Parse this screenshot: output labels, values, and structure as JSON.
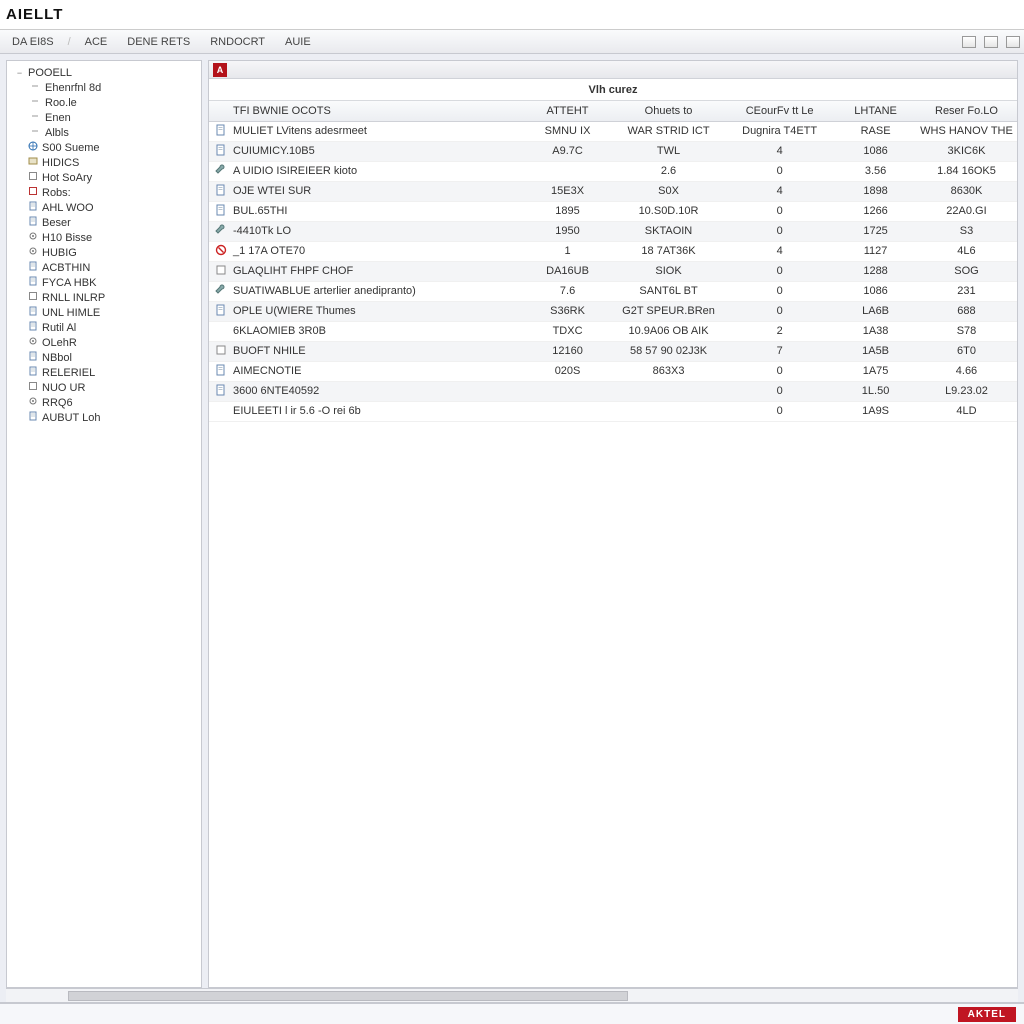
{
  "app": {
    "brand": "AIELLT"
  },
  "menu": {
    "items": [
      "DA EI8S",
      "ACE",
      "DENE RETS",
      "RNDOCRT",
      "AUIE"
    ]
  },
  "sidebar": {
    "root": "POOELL",
    "items": [
      {
        "label": "Ehenrfnl 8d",
        "icon": "dash",
        "indent": 1
      },
      {
        "label": "Roo.le",
        "icon": "dash",
        "indent": 1
      },
      {
        "label": "Enen",
        "icon": "dash",
        "indent": 1
      },
      {
        "label": "Albls",
        "icon": "dash",
        "indent": 1
      },
      {
        "label": "S00 Sueme",
        "icon": "globe",
        "indent": 0
      },
      {
        "label": "HIDICS",
        "icon": "box",
        "indent": 0
      },
      {
        "label": "Hot SoAry",
        "icon": "sq",
        "indent": 0
      },
      {
        "label": "Robs:",
        "icon": "sq-red",
        "indent": 0
      },
      {
        "label": "AHL WOO",
        "icon": "doc",
        "indent": 0
      },
      {
        "label": "Beser",
        "icon": "doc",
        "indent": 0
      },
      {
        "label": "H10 Bisse",
        "icon": "gear",
        "indent": 0
      },
      {
        "label": "HUBIG",
        "icon": "gear",
        "indent": 0
      },
      {
        "label": "ACBTHIN",
        "icon": "doc",
        "indent": 0
      },
      {
        "label": "FYCA HBK",
        "icon": "doc",
        "indent": 0
      },
      {
        "label": "RNLL INLRP",
        "icon": "sq",
        "indent": 0
      },
      {
        "label": "UNL HIMLE",
        "icon": "doc",
        "indent": 0
      },
      {
        "label": "Rutil Al",
        "icon": "doc",
        "indent": 0
      },
      {
        "label": "OLehR",
        "icon": "gear",
        "indent": 0
      },
      {
        "label": "NBbol",
        "icon": "doc",
        "indent": 0
      },
      {
        "label": "RELERIEL",
        "icon": "doc",
        "indent": 0
      },
      {
        "label": "NUO UR",
        "icon": "sq",
        "indent": 0
      },
      {
        "label": "RRQ6",
        "icon": "gear",
        "indent": 0
      },
      {
        "label": "AUBUT Loh",
        "icon": "doc",
        "indent": 0
      }
    ]
  },
  "main": {
    "badge": "A",
    "subtitle": "Vlh curez",
    "columns": [
      "TFI BWNIE OCOTS",
      "ATTEHT",
      "Ohuets to",
      "CEourFv tt Le",
      "LHTANE",
      "Reser Fo.LO"
    ],
    "rows": [
      {
        "icon": "doc",
        "name": "MULIET LVitens adesrmeet",
        "c1": "SMNU IX",
        "c2": "WAR STRID ICT",
        "c3": "Dugnira T4ETT",
        "c4": "RASE",
        "c5": "WHS HANOV THE"
      },
      {
        "icon": "doc",
        "name": "CUIUMICY.10B5",
        "c1": "A9.7C",
        "c2": "TWL",
        "c3": "4",
        "c4": "1086",
        "c5": "3KIC6K"
      },
      {
        "icon": "wrench",
        "name": "A UIDIO ISIREIEER kioto",
        "c1": "",
        "c2": "2.6",
        "c3": "0",
        "c4": "3.56",
        "c5": "1.84 16OK5"
      },
      {
        "icon": "doc",
        "name": "OJE WTEI SUR",
        "c1": "15E3X",
        "c2": "S0X",
        "c3": "4",
        "c4": "1898",
        "c5": "8630K"
      },
      {
        "icon": "doc",
        "name": "BUL.65THI",
        "c1": "1895",
        "c2": "10.S0D.10R",
        "c3": "0",
        "c4": "1266",
        "c5": "22A0.GI"
      },
      {
        "icon": "wrench",
        "name": "-4410Tk LO",
        "c1": "1950",
        "c2": "SKTAOIN",
        "c3": "0",
        "c4": "1725",
        "c5": "S3"
      },
      {
        "icon": "red",
        "name": "_1 17A OTE70",
        "c1": "1",
        "c2": "18 7AT36K",
        "c3": "4",
        "c4": "1127",
        "c5": "4L6"
      },
      {
        "icon": "sq",
        "name": "GLAQLIHT FHPF CHOF",
        "c1": "DA16UB",
        "c2": "SIOK",
        "c3": "0",
        "c4": "1288",
        "c5": "SOG"
      },
      {
        "icon": "wrench",
        "name": "SUATIWABLUE arterlier anedipranto)",
        "c1": "7.6",
        "c2": "SANT6L BT",
        "c3": "0",
        "c4": "1086",
        "c5": "231"
      },
      {
        "icon": "doc",
        "name": "OPLE U(WIERE Thumes",
        "c1": "S36RK",
        "c2": "G2T SPEUR.BRen",
        "c3": "0",
        "c4": "LA6B",
        "c5": "688"
      },
      {
        "icon": "blank",
        "name": "  6KLAOMIEB 3R0B",
        "c1": "TDXC",
        "c2": "10.9A06 OB AIK",
        "c3": "2",
        "c4": "1A38",
        "c5": "S78"
      },
      {
        "icon": "sq",
        "name": "BUOFT NHILE",
        "c1": "12160",
        "c2": "58 57 90 02J3K",
        "c3": "7",
        "c4": "1A5B",
        "c5": "6T0"
      },
      {
        "icon": "doc",
        "name": "AIMECNOTIE",
        "c1": "020S",
        "c2": "863X3",
        "c3": "0",
        "c4": "1A75",
        "c5": "4.66"
      },
      {
        "icon": "doc",
        "name": "3600 6NTE40592",
        "c1": "",
        "c2": "",
        "c3": "0",
        "c4": "1L.50",
        "c5": "L9.23.02"
      },
      {
        "icon": "blank",
        "name": "EIULEETI l ir 5.6 -O rei 6b",
        "c1": "",
        "c2": "",
        "c3": "0",
        "c4": "1A9S",
        "c5": "4LD"
      }
    ]
  },
  "status": {
    "logo": "AKTEL"
  }
}
